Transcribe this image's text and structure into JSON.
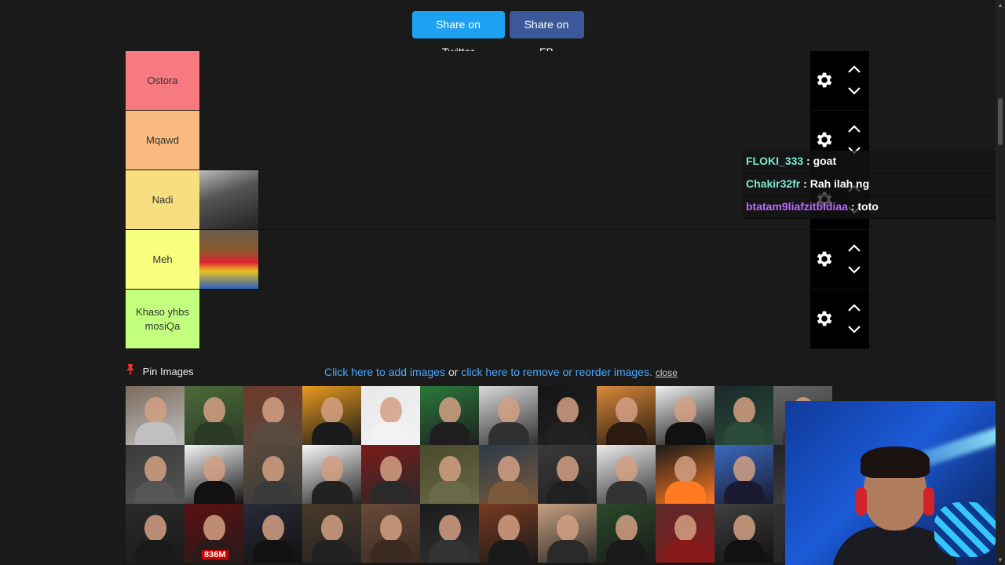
{
  "share": {
    "twitter_label": "Share on Twitter",
    "fb_label": "Share on FB"
  },
  "tiers": [
    {
      "label": "Ostora",
      "color": "#f67a80",
      "images": []
    },
    {
      "label": "Mqawd",
      "color": "#f9bb7f",
      "images": []
    },
    {
      "label": "Nadi",
      "color": "#f9de7f",
      "images": [
        "photo-man-bw"
      ]
    },
    {
      "label": "Meh",
      "color": "#f9ff7f",
      "images": [
        "photo-man-colorful-jacket"
      ]
    },
    {
      "label": "Khaso yhbs mosiQa",
      "color": "#c2ff7f",
      "images": []
    }
  ],
  "pin": {
    "label": "Pin Images"
  },
  "links": {
    "add": "Click here to add images",
    "or": " or ",
    "remove": "click here to remove or reorder images.",
    "close": "close"
  },
  "gallery": {
    "badge_text": "836M",
    "tiles": [
      [
        "#7a6a5a",
        "#c0c0c0"
      ],
      [
        "#4d6b3a",
        "#2a3a25"
      ],
      [
        "#6b3a2a",
        "#5a4a40"
      ],
      [
        "#e89a20",
        "#1a1a1a"
      ],
      [
        "#e8e8e8",
        "#f2f2f2"
      ],
      [
        "#2a7a3a",
        "#1e1e1e"
      ],
      [
        "#d8d8d8",
        "#303030"
      ],
      [
        "#151515",
        "#222"
      ],
      [
        "#d88a3a",
        "#2a1a10"
      ],
      [
        "#f0f0f0",
        "#111"
      ],
      [
        "#1a2a2a",
        "#2a4a3a"
      ],
      [
        "#666",
        "#333"
      ],
      [
        "#3a3a3a",
        "#555"
      ],
      [
        "#f4f4f4",
        "#111"
      ],
      [
        "#5a4a3a",
        "#3a3a3a"
      ],
      [
        "#f8f8f8",
        "#222"
      ],
      [
        "#7a1a1a",
        "#2a2a2a"
      ],
      [
        "#4a4a2a",
        "#6a6a4a"
      ],
      [
        "#2a3a4a",
        "#7a5a3a"
      ],
      [
        "#3a3a3a",
        "#202020"
      ],
      [
        "#ececec",
        "#333"
      ],
      [
        "#1a1a1a",
        "#ff7a20"
      ],
      [
        "#3a6ac0",
        "#1a1a30"
      ],
      [
        "#222",
        "#444"
      ],
      [
        "#2a2a2a",
        "#1a1a1a"
      ],
      [
        "#5a1010",
        "#2a1a1a"
      ],
      [
        "#2a2a3a",
        "#111"
      ],
      [
        "#4a3a2a",
        "#222"
      ],
      [
        "#6a4a3a",
        "#3a2a20"
      ],
      [
        "#1a1a1a",
        "#333"
      ],
      [
        "#7a3a20",
        "#1a1a1a"
      ],
      [
        "#c8a080",
        "#2a2a2a"
      ],
      [
        "#2a4a2a",
        "#1a1a1a"
      ],
      [
        "#5a2a2a",
        "#8a1a1a"
      ],
      [
        "#404040",
        "#111"
      ],
      [
        "#333",
        "#222"
      ]
    ]
  },
  "chat": [
    {
      "user": "FLOKI_333",
      "message": " : goat"
    },
    {
      "user": "Chakir32fr",
      "message": " : Rah ilah ng"
    },
    {
      "user": "btatam9liafzitbldiaa",
      "message": " : toto"
    }
  ]
}
